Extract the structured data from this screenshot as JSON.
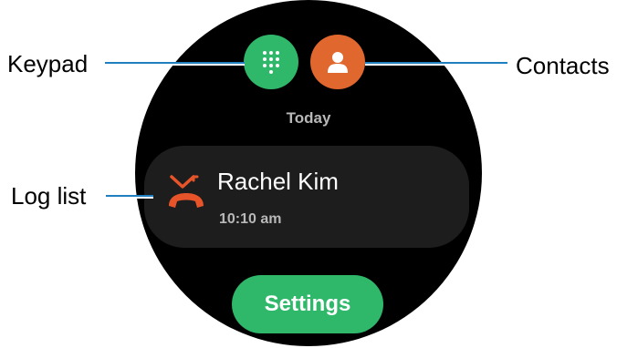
{
  "callouts": {
    "keypad": "Keypad",
    "contacts": "Contacts",
    "log_list": "Log list"
  },
  "screen": {
    "section_header": "Today",
    "log_entries": [
      {
        "name": "Rachel Kim",
        "time": "10:10 am",
        "type": "missed-call-icon"
      }
    ],
    "settings_label": "Settings"
  },
  "colors": {
    "keypad_button": "#2fb86a",
    "contacts_button": "#e0672e",
    "missed_call": "#e8542a",
    "settings_button": "#2fb86a",
    "leader_line": "#1f7fbf"
  }
}
